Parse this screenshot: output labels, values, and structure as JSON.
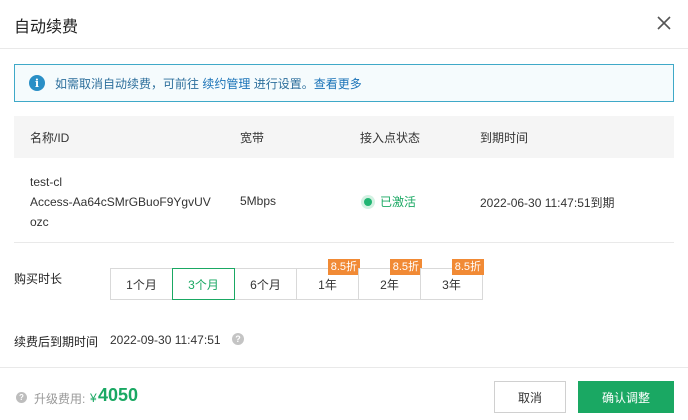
{
  "dialog": {
    "title": "自动续费",
    "close_icon": "close-icon"
  },
  "notice": {
    "icon": "info-icon",
    "text_before": "如需取消自动续费，可前往 ",
    "link_manage": "续约管理",
    "text_middle": " 进行设置。",
    "link_more": "查看更多"
  },
  "table": {
    "headers": {
      "name": "名称/ID",
      "bandwidth": "宽带",
      "status": "接入点状态",
      "expire": "到期时间"
    },
    "row": {
      "name_line1": "test-cl",
      "name_line2": "Access-Aa64cSMrGBuoF9YgvUV",
      "name_line3": "ozc",
      "bandwidth": "5Mbps",
      "status": "已激活",
      "expire": "2022-06-30 11:47:51到期"
    }
  },
  "duration": {
    "label": "购买时长",
    "options": [
      {
        "label": "1个月",
        "badge": ""
      },
      {
        "label": "3个月",
        "badge": ""
      },
      {
        "label": "6个月",
        "badge": ""
      },
      {
        "label": "1年",
        "badge": "8.5折"
      },
      {
        "label": "2年",
        "badge": "8.5折"
      },
      {
        "label": "3年",
        "badge": "8.5折"
      }
    ],
    "selected": "3个月"
  },
  "renewal": {
    "label": "续费后到期时间",
    "value": "2022-09-30 11:47:51",
    "help_icon": "help-icon"
  },
  "footer": {
    "fee_label": "升级费用:",
    "currency": "¥",
    "amount": "4050",
    "cancel_label": "取消",
    "confirm_label": "确认调整"
  },
  "colors": {
    "accent": "#1aa863",
    "badge": "#f18a35",
    "notice_border": "#3fa9c8"
  }
}
